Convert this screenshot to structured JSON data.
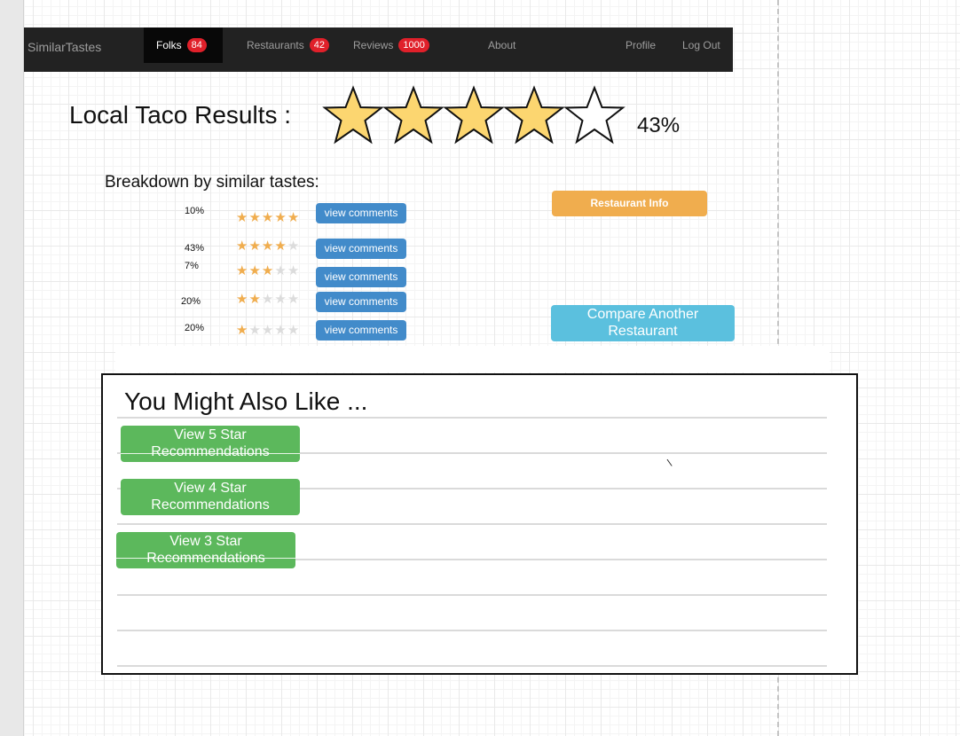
{
  "navbar": {
    "brand": "SimilarTastes",
    "items": [
      {
        "label": "Folks",
        "badge": "84",
        "active": true
      },
      {
        "label": "Restaurants",
        "badge": "42"
      },
      {
        "label": "Reviews",
        "badge": "1000"
      },
      {
        "label": "About"
      },
      {
        "label": "Profile"
      },
      {
        "label": "Log Out"
      }
    ]
  },
  "results": {
    "title": "Local Taco Results :",
    "rating_stars_filled": 4,
    "rating_stars_total": 5,
    "score": "43%"
  },
  "breakdown": {
    "title": "Breakdown by similar tastes:",
    "rows": [
      {
        "percent": "10%",
        "stars": 5,
        "button": "view comments"
      },
      {
        "percent": "43%",
        "stars": 4,
        "button": "view comments"
      },
      {
        "percent": "7%",
        "stars": 3,
        "button": "view comments"
      },
      {
        "percent": "20%",
        "stars": 2,
        "button": "view comments"
      },
      {
        "percent": "20%",
        "stars": 1,
        "button": "view comments"
      }
    ]
  },
  "actions": {
    "restaurant_info": "Restaurant Info",
    "compare": "Compare Another Restaurant"
  },
  "recommendations": {
    "title": "You Might Also Like ...",
    "buttons": [
      "View 5 Star Recommendations",
      "View 4 Star Recommendations",
      "View 3 Star Recommendations"
    ],
    "stray_mark": "\\"
  },
  "colors": {
    "star_fill": "#fcd670",
    "star_on": "#f0ad4e",
    "primary": "#428bca",
    "warning": "#f0ad4e",
    "info": "#5bc0de",
    "success": "#5cb85c",
    "badge": "#e0202a"
  }
}
